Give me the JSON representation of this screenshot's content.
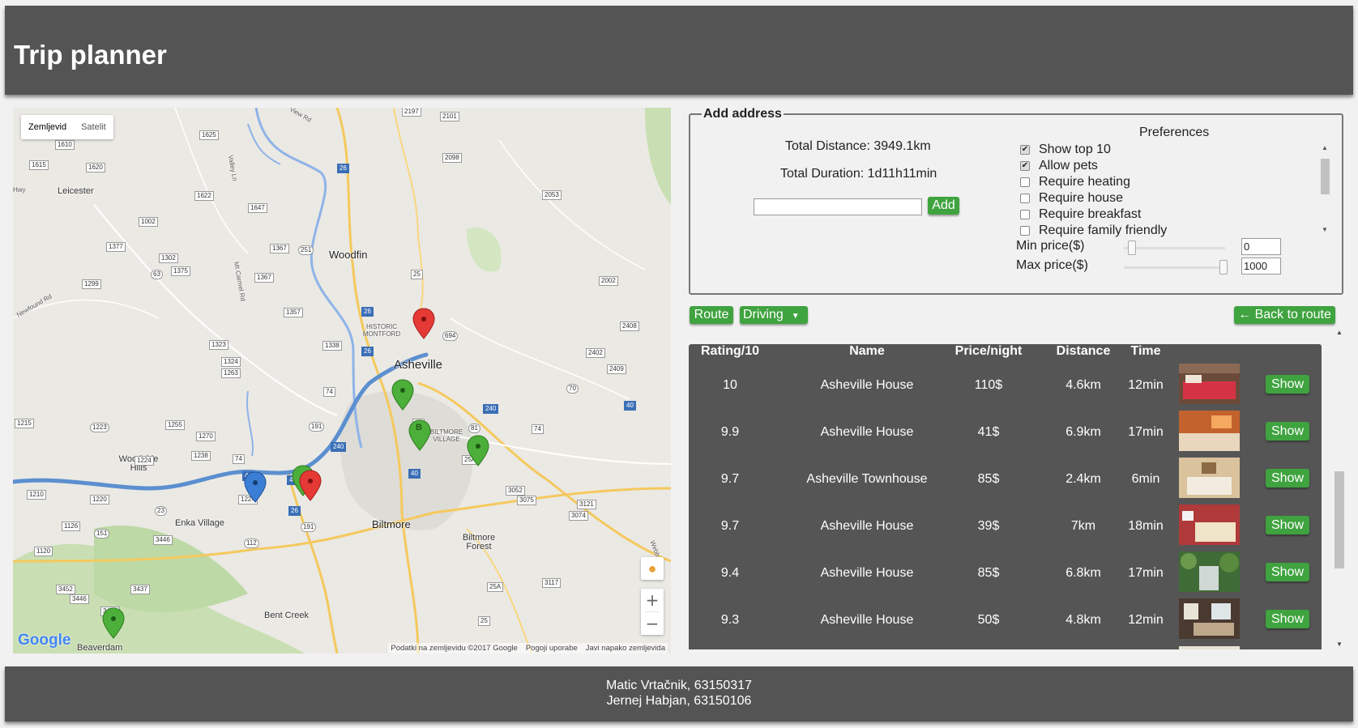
{
  "header": {
    "title": "Trip planner"
  },
  "map": {
    "type_buttons": [
      "Zemljevid",
      "Satelit"
    ],
    "zoom_in": "+",
    "zoom_out": "−",
    "google": "Google",
    "footer": [
      "Podatki na zemljevidu ©2017 Google",
      "Pogoji uporabe",
      "Javi napako zemljevida"
    ],
    "places": {
      "leicester": "Leicester",
      "woodfin": "Woodfin",
      "asheville": "Asheville",
      "historic_montford": "HISTORIC MONTFORD",
      "biltmore_village": "BILTMORE VILLAGE",
      "woodside_hills": "Woodside Hills",
      "enka_village": "Enka Village",
      "biltmore": "Biltmore",
      "biltmore_forest": "Biltmore Forest",
      "bent_creek": "Bent Creek",
      "beaverdam": "Beaverdam",
      "newfound_rd": "Newfound Rd",
      "hwy": "Hwy",
      "view_rd": "View Rd",
      "mt_carmel_rd": "Mt Carmel Rd",
      "webb": "Webb",
      "valley_ln": "Valley Ln"
    },
    "shields": {
      "s1625": "1625",
      "s1610": "1610",
      "s1615": "1615",
      "s1620": "1620",
      "s1622": "1622",
      "s1647": "1647",
      "s1002": "1002",
      "s1377": "1377",
      "s1302": "1302",
      "s1375": "1375",
      "s1299": "1299",
      "s63": "63",
      "s1367a": "1367",
      "s251": "251",
      "s1367b": "1367",
      "s1357": "1357",
      "s1323": "1323",
      "s1338": "1338",
      "s1324": "1324",
      "s1263": "1263",
      "s1215": "1215",
      "s1223": "1223",
      "s1255": "1255",
      "s1270": "1270",
      "s1224a": "1224",
      "s1238": "1238",
      "s1210": "1210",
      "s1220": "1220",
      "s23": "23",
      "s1224b": "1224",
      "s1126": "1126",
      "s151": "151",
      "s3446a": "3446",
      "s1120": "1120",
      "s3452": "3452",
      "s3446b": "3446",
      "s3449": "3449",
      "s3437": "3437",
      "s112": "112",
      "s191a": "191",
      "s191b": "191",
      "s2197": "2197",
      "s2101": "2101",
      "s2098": "2098",
      "s2053": "2053",
      "s2002": "2002",
      "s2408": "2408",
      "s2402": "2402",
      "s2409": "2409",
      "s70": "70",
      "s694": "694",
      "s81": "81",
      "s3052": "3052",
      "s3075": "3075",
      "s3121": "3121",
      "s3074": "3074",
      "s3117": "3117",
      "i26a": "26",
      "i26b": "26",
      "i26c": "26",
      "i26d": "26",
      "i240a": "240",
      "i240b": "240",
      "i40a": "40",
      "i40b": "40",
      "i40c": "40",
      "i40d": "40",
      "us25a": "25",
      "us25b": "25",
      "us25c": "25",
      "us74a": "74",
      "us74b": "74",
      "us74c": "74",
      "us25a_alt": "25A",
      "us25a2": "25A"
    },
    "marker_b_label": "B"
  },
  "add_address": {
    "legend": "Add address",
    "total_distance": "Total Distance: 3949.1km",
    "total_duration": "Total Duration: 1d11h11min",
    "address_value": "",
    "add_button": "Add",
    "preferences_title": "Preferences",
    "preferences": [
      {
        "label": "Show top 10",
        "checked": true
      },
      {
        "label": "Allow pets",
        "checked": true
      },
      {
        "label": "Require heating",
        "checked": false
      },
      {
        "label": "Require house",
        "checked": false
      },
      {
        "label": "Require breakfast",
        "checked": false
      },
      {
        "label": "Require family friendly",
        "checked": false
      }
    ],
    "min_price_label": "Min price($)",
    "max_price_label": "Max price($)",
    "min_price_value": "0",
    "max_price_value": "1000"
  },
  "route_bar": {
    "route_button": "Route",
    "travel_mode": "Driving",
    "back_button": "← Back to route"
  },
  "results": {
    "columns": [
      "Rating/10",
      "Name",
      "Price/night",
      "Distance",
      "Time"
    ],
    "rows": [
      {
        "rating": "10",
        "name": "Asheville House",
        "price": "110$",
        "distance": "4.6km",
        "time": "12min",
        "show": "Show"
      },
      {
        "rating": "9.9",
        "name": "Asheville House",
        "price": "41$",
        "distance": "6.9km",
        "time": "17min",
        "show": "Show"
      },
      {
        "rating": "9.7",
        "name": "Asheville Townhouse",
        "price": "85$",
        "distance": "2.4km",
        "time": "6min",
        "show": "Show"
      },
      {
        "rating": "9.7",
        "name": "Asheville House",
        "price": "39$",
        "distance": "7km",
        "time": "18min",
        "show": "Show"
      },
      {
        "rating": "9.4",
        "name": "Asheville House",
        "price": "85$",
        "distance": "6.8km",
        "time": "17min",
        "show": "Show"
      },
      {
        "rating": "9.3",
        "name": "Asheville House",
        "price": "50$",
        "distance": "4.8km",
        "time": "12min",
        "show": "Show"
      }
    ]
  },
  "footer": {
    "line1": "Matic Vrtačnik, 63150317",
    "line2": "Jernej Habjan, 63150106"
  },
  "colors": {
    "header_bg": "#545454",
    "accent_green": "#3fa33f",
    "table_bg": "#555555",
    "marker_green": "#4caf3a",
    "marker_red": "#e53935",
    "marker_blue": "#3a7fd5",
    "route_blue": "#5b8fd0"
  }
}
